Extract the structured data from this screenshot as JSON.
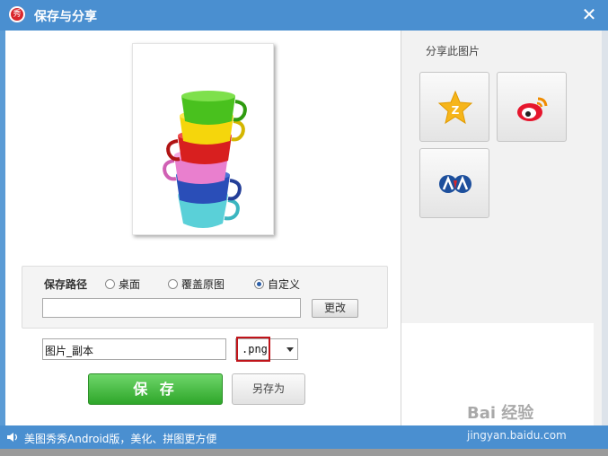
{
  "window": {
    "title": "保存与分享",
    "logo_text": "秀",
    "close_glyph": "✕"
  },
  "save_path": {
    "label": "保存路径",
    "options": [
      {
        "label": "桌面",
        "selected": false
      },
      {
        "label": "覆盖原图",
        "selected": false
      },
      {
        "label": "自定义",
        "selected": true
      }
    ],
    "path_value": "",
    "change_label": "更改"
  },
  "file": {
    "name_value": "图片_副本",
    "format_value": ".png"
  },
  "actions": {
    "save_label": "保 存",
    "save_as_label": "另存为"
  },
  "share": {
    "title": "分享此图片",
    "targets": [
      {
        "name": "qzone-icon"
      },
      {
        "name": "weibo-icon"
      },
      {
        "name": "renren-icon"
      }
    ]
  },
  "status": {
    "text": "美图秀秀Android版，美化、拼图更方便"
  },
  "watermark": {
    "brand": "Bai 经验",
    "url": "jingyan.baidu.com"
  },
  "colors": {
    "title_bar": "#4a8fd0",
    "save_button": "#2ea62a",
    "format_highlight": "#c0141a"
  }
}
